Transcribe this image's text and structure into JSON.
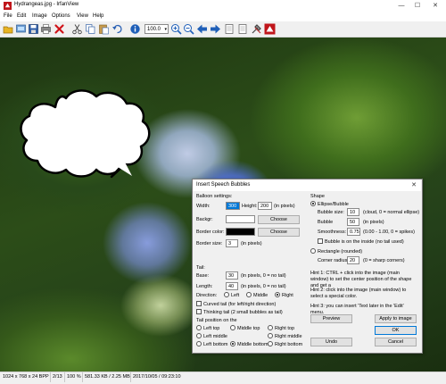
{
  "window": {
    "title": "Hydrangeas.jpg - IrfanView",
    "minimize_glyph": "—",
    "maximize_glyph": "☐",
    "close_glyph": "✕"
  },
  "menu": [
    "File",
    "Edit",
    "Image",
    "Options",
    "View",
    "Help"
  ],
  "toolbar": {
    "zoom_value": "100.0",
    "icons": [
      "open-folder-icon",
      "slideshow-icon",
      "save-icon",
      "print-icon",
      "delete-icon",
      "cut-icon",
      "copy-icon",
      "paste-icon",
      "undo-icon",
      "info-icon",
      "zoom-select",
      "zoom-in-icon",
      "zoom-out-icon",
      "previous-icon",
      "next-icon",
      "first-page-icon",
      "last-page-icon",
      "settings-icon",
      "irfanview-logo-icon"
    ]
  },
  "status": {
    "dimensions": "1024 x 768 x 24 BPP",
    "index": "2/13",
    "zoom": "100 %",
    "size": "581.33 KB / 2.25 MB",
    "date": "2017/10/05 / 09:23:10"
  },
  "dialog": {
    "title": "Insert Speech Bubbles",
    "close_glyph": "✕",
    "balloon_settings": {
      "heading": "Balloon settings:",
      "width_label": "Width:",
      "width_value": "300",
      "height_label": "Height:",
      "height_value": "200",
      "size_unit": "(in pixels)",
      "backgr_label": "Backgr:",
      "backgr_color": "#ffffff",
      "choose1": "Choose",
      "border_color_label": "Border color:",
      "border_color": "#000000",
      "choose2": "Choose",
      "border_size_label": "Border size:",
      "border_size_value": "3",
      "border_size_unit": "(in pixels)"
    },
    "tail": {
      "heading": "Tail:",
      "base_label": "Base:",
      "base_value": "30",
      "base_unit": "(in pixels, 0 = no tail)",
      "length_label": "Length:",
      "length_value": "40",
      "length_unit": "(in pixels, 0 = no tail)",
      "direction_label": "Direction:",
      "dir_left": "Left",
      "dir_middle": "Middle",
      "dir_right": "Right",
      "curved_label": "Curved tail (for left/right direction)",
      "thinking_label": "Thinking tail (2 small bubbles as tail)",
      "position_label": "Tail position on the",
      "pos_left_top": "Left top",
      "pos_middle_top": "Middle top",
      "pos_right_top": "Right top",
      "pos_left_middle": "Left middle",
      "pos_right_middle": "Right middle",
      "pos_left_bottom": "Left bottom",
      "pos_middle_bottom": "Middle bottom",
      "pos_right_bottom": "Right bottom"
    },
    "shape": {
      "heading": "Shape",
      "ellipse_label": "Ellipse/Bubble",
      "bubble_size_label": "Bubble size:",
      "bubble_size_value": "10",
      "bubble_size_note": "(cloud, 0 = normal ellipse)",
      "bubble_label": "Bubble",
      "bubble_value": "50",
      "bubble_unit": "(in pixels)",
      "smoothness_label": "Smoothness:",
      "smoothness_value": "0.75",
      "smoothness_note": "(0.00 - 1.00, 0 = spikes)",
      "inside_label": "Bubble is on the inside (no tail used)",
      "rectangle_label": "Rectangle (rounded)",
      "corner_label": "Corner radius:",
      "corner_value": "20",
      "corner_note": "(0 = sharp corners)"
    },
    "hints": {
      "hint1": "Hint 1: CTRL + click into the image (main window) to set the center position of the shape and get a",
      "hint2": "Hint 2: click into the image (main window) to select a special color.",
      "hint3": "Hint 3: you can insert 'Text later in the 'Edit' menu."
    },
    "buttons": {
      "preview": "Preview",
      "apply": "Apply to image",
      "ok": "OK",
      "undo": "Undo",
      "cancel": "Cancel"
    }
  }
}
